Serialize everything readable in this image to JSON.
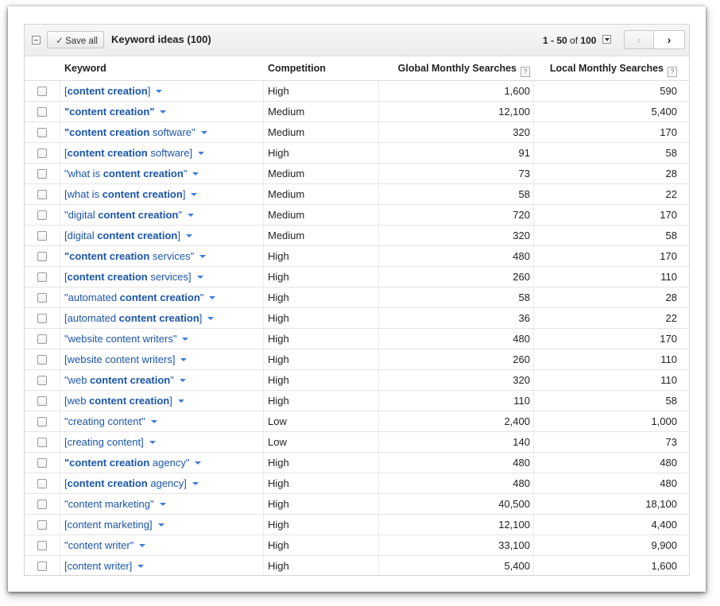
{
  "toolbar": {
    "save_label": "Save all",
    "title": "Keyword ideas (100)",
    "pager_range": "1 - 50",
    "pager_of": "of",
    "pager_total": "100"
  },
  "columns": {
    "keyword": "Keyword",
    "competition": "Competition",
    "global": "Global Monthly Searches",
    "local": "Local Monthly Searches",
    "help": "?"
  },
  "rows": [
    {
      "parts": [
        [
          "[",
          false
        ],
        [
          "content creation",
          true
        ],
        [
          "]",
          false
        ]
      ],
      "competition": "High",
      "global": "1,600",
      "local": "590"
    },
    {
      "parts": [
        [
          "\"",
          true
        ],
        [
          "content creation",
          true
        ],
        [
          "\"",
          true
        ]
      ],
      "competition": "Medium",
      "global": "12,100",
      "local": "5,400"
    },
    {
      "parts": [
        [
          "\"",
          true
        ],
        [
          "content creation",
          true
        ],
        [
          " software\"",
          false
        ]
      ],
      "competition": "Medium",
      "global": "320",
      "local": "170"
    },
    {
      "parts": [
        [
          "[",
          false
        ],
        [
          "content creation",
          true
        ],
        [
          " software]",
          false
        ]
      ],
      "competition": "High",
      "global": "91",
      "local": "58"
    },
    {
      "parts": [
        [
          "\"what is ",
          false
        ],
        [
          "content creation",
          true
        ],
        [
          "\"",
          false
        ]
      ],
      "competition": "Medium",
      "global": "73",
      "local": "28"
    },
    {
      "parts": [
        [
          "[what is ",
          false
        ],
        [
          "content creation",
          true
        ],
        [
          "]",
          false
        ]
      ],
      "competition": "Medium",
      "global": "58",
      "local": "22"
    },
    {
      "parts": [
        [
          "\"digital ",
          false
        ],
        [
          "content creation",
          true
        ],
        [
          "\"",
          false
        ]
      ],
      "competition": "Medium",
      "global": "720",
      "local": "170"
    },
    {
      "parts": [
        [
          "[digital ",
          false
        ],
        [
          "content creation",
          true
        ],
        [
          "]",
          false
        ]
      ],
      "competition": "Medium",
      "global": "320",
      "local": "58"
    },
    {
      "parts": [
        [
          "\"",
          true
        ],
        [
          "content creation",
          true
        ],
        [
          " services\"",
          false
        ]
      ],
      "competition": "High",
      "global": "480",
      "local": "170"
    },
    {
      "parts": [
        [
          "[",
          false
        ],
        [
          "content creation",
          true
        ],
        [
          " services]",
          false
        ]
      ],
      "competition": "High",
      "global": "260",
      "local": "110"
    },
    {
      "parts": [
        [
          "\"automated ",
          false
        ],
        [
          "content creation",
          true
        ],
        [
          "\"",
          false
        ]
      ],
      "competition": "High",
      "global": "58",
      "local": "28"
    },
    {
      "parts": [
        [
          "[automated ",
          false
        ],
        [
          "content creation",
          true
        ],
        [
          "]",
          false
        ]
      ],
      "competition": "High",
      "global": "36",
      "local": "22"
    },
    {
      "parts": [
        [
          "\"website content writers\"",
          false
        ]
      ],
      "competition": "High",
      "global": "480",
      "local": "170"
    },
    {
      "parts": [
        [
          "[website content writers]",
          false
        ]
      ],
      "competition": "High",
      "global": "260",
      "local": "110"
    },
    {
      "parts": [
        [
          "\"web ",
          false
        ],
        [
          "content creation",
          true
        ],
        [
          "\"",
          false
        ]
      ],
      "competition": "High",
      "global": "320",
      "local": "110"
    },
    {
      "parts": [
        [
          "[web ",
          false
        ],
        [
          "content creation",
          true
        ],
        [
          "]",
          false
        ]
      ],
      "competition": "High",
      "global": "110",
      "local": "58"
    },
    {
      "parts": [
        [
          "\"creating content\"",
          false
        ]
      ],
      "competition": "Low",
      "global": "2,400",
      "local": "1,000"
    },
    {
      "parts": [
        [
          "[creating content]",
          false
        ]
      ],
      "competition": "Low",
      "global": "140",
      "local": "73"
    },
    {
      "parts": [
        [
          "\"",
          true
        ],
        [
          "content creation",
          true
        ],
        [
          " agency\"",
          false
        ]
      ],
      "competition": "High",
      "global": "480",
      "local": "480"
    },
    {
      "parts": [
        [
          "[",
          false
        ],
        [
          "content creation",
          true
        ],
        [
          " agency]",
          false
        ]
      ],
      "competition": "High",
      "global": "480",
      "local": "480"
    },
    {
      "parts": [
        [
          "\"content marketing\"",
          false
        ]
      ],
      "competition": "High",
      "global": "40,500",
      "local": "18,100"
    },
    {
      "parts": [
        [
          "[content marketing]",
          false
        ]
      ],
      "competition": "High",
      "global": "12,100",
      "local": "4,400"
    },
    {
      "parts": [
        [
          "\"content writer\"",
          false
        ]
      ],
      "competition": "High",
      "global": "33,100",
      "local": "9,900"
    },
    {
      "parts": [
        [
          "[content writer]",
          false
        ]
      ],
      "competition": "High",
      "global": "5,400",
      "local": "1,600"
    }
  ]
}
